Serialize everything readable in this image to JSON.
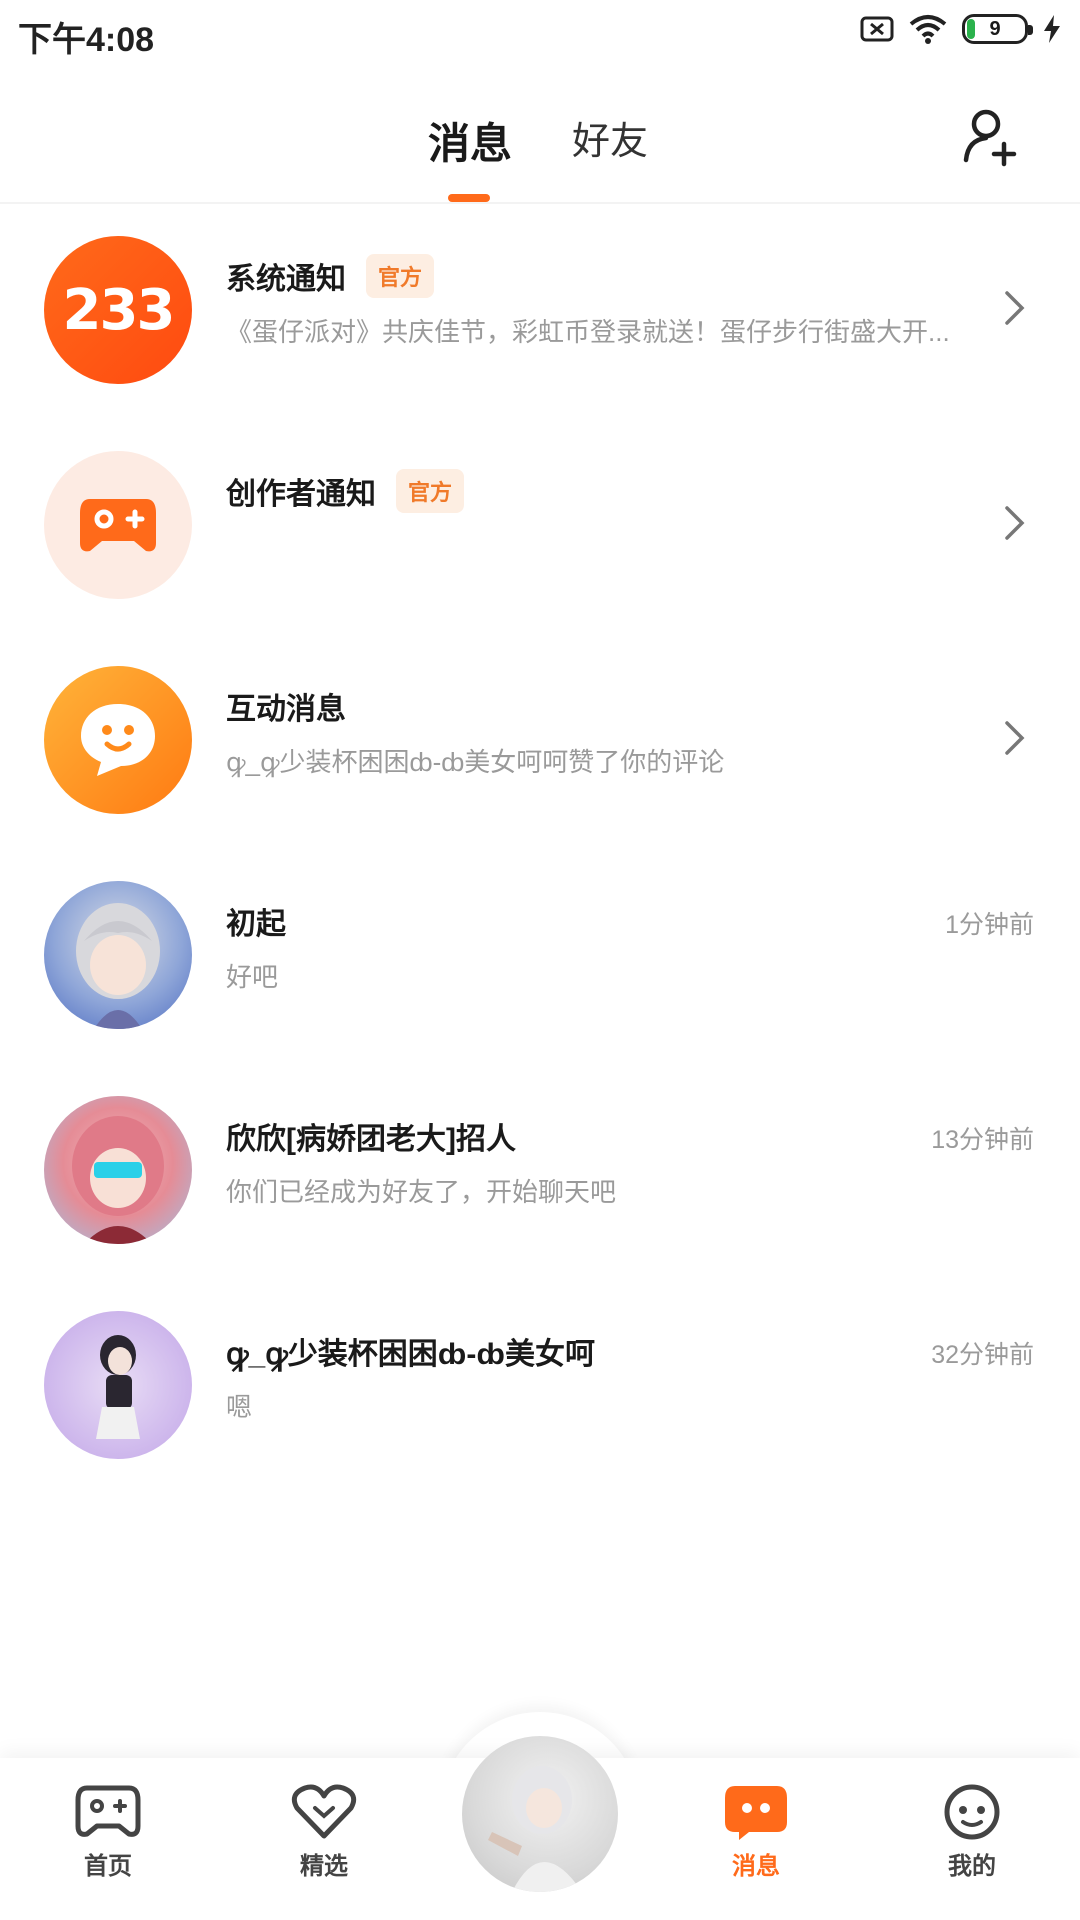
{
  "status_bar": {
    "time": "下午4:08",
    "battery_level": "9",
    "icons": [
      "sim-off-icon",
      "wifi-icon",
      "battery-icon",
      "charging-icon"
    ]
  },
  "header": {
    "tabs": [
      {
        "label": "消息",
        "active": true
      },
      {
        "label": "好友",
        "active": false
      }
    ],
    "action_icon": "add-friend-icon",
    "accent_color": "#ff6a1a"
  },
  "conversations": [
    {
      "avatar": "233-logo",
      "avatar_text": "233",
      "name": "系统通知",
      "badge": "官方",
      "preview": "《蛋仔派对》共庆佳节，彩虹币登录就送！蛋仔步行街盛大开...",
      "has_chevron": true
    },
    {
      "avatar": "gamepad-icon",
      "name": "创作者通知",
      "badge": "官方",
      "preview": "",
      "has_chevron": true
    },
    {
      "avatar": "chat-bubble-icon",
      "name": "互动消息",
      "badge": "",
      "preview": "ꝙ_ꝙ少装杯困困ȸ-ȸ美女呵呵赞了你的评论",
      "has_chevron": true
    },
    {
      "avatar": "user-avatar",
      "name": "初起",
      "preview": "好吧",
      "time": "1分钟前"
    },
    {
      "avatar": "user-avatar",
      "name": "欣欣[病娇团老大]招人",
      "preview": "你们已经成为好友了，开始聊天吧",
      "time": "13分钟前"
    },
    {
      "avatar": "user-avatar",
      "name": "ꝙ_ꝙ少装杯困困ȸ-ȸ美女呵",
      "preview": "嗯",
      "time": "32分钟前"
    }
  ],
  "bottom_nav": {
    "items": [
      {
        "label": "首页",
        "icon": "gamepad-icon",
        "active": false
      },
      {
        "label": "精选",
        "icon": "heart-icon",
        "active": false
      },
      {
        "label": "",
        "icon": "avatar-center",
        "active": false
      },
      {
        "label": "消息",
        "icon": "message-icon",
        "active": true
      },
      {
        "label": "我的",
        "icon": "face-icon",
        "active": false
      }
    ]
  }
}
